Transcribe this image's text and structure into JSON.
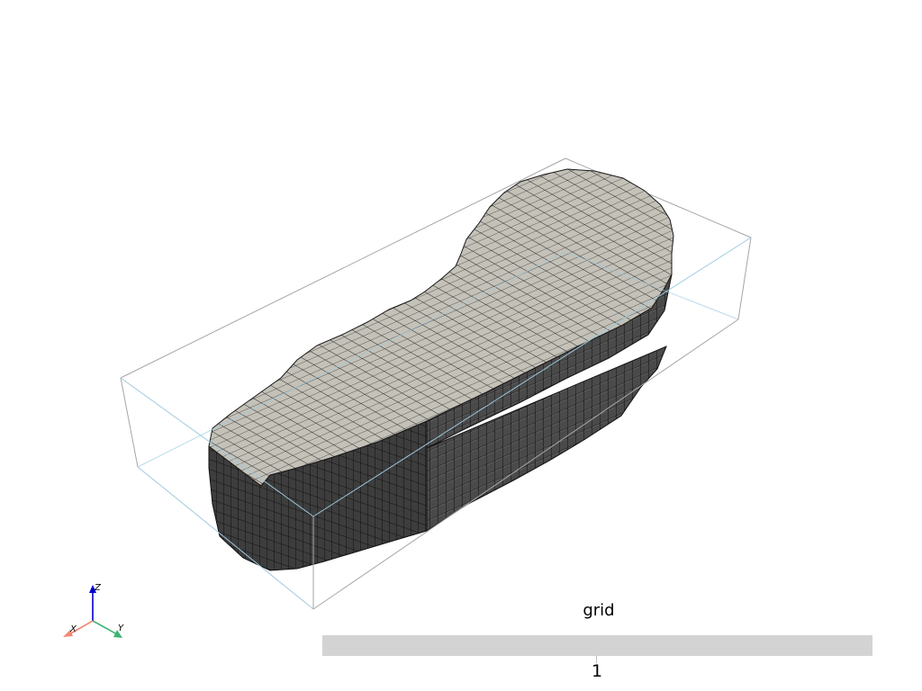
{
  "scene": {
    "mesh_name": "grid",
    "mesh_color": "#c4c1b8",
    "side_color": "#444444",
    "edge_color": "#1a1a1a",
    "bounding_box_color": "#a6a6a6",
    "bounding_box_front_color": "#9ecae1"
  },
  "orientation_axes": {
    "x_label": "X",
    "y_label": "Y",
    "z_label": "Z",
    "x_color": "#f08872",
    "y_color": "#3cb371",
    "z_color": "#0000cd"
  },
  "scalar_bar": {
    "title": "grid",
    "tick_label": "1",
    "bar_color": "#d3d3d3"
  }
}
